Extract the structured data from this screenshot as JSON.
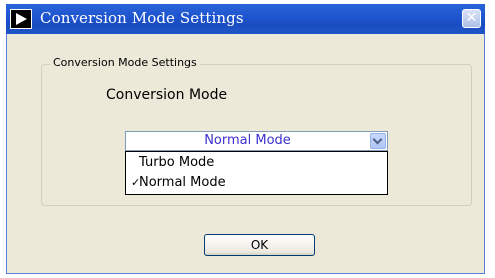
{
  "window": {
    "title": "Conversion Mode Settings",
    "close_symbol": "✕"
  },
  "group": {
    "label": "Conversion Mode Settings"
  },
  "field": {
    "label": "Conversion Mode",
    "selected_value": "Normal Mode"
  },
  "dropdown": {
    "options": [
      {
        "label": "Turbo Mode",
        "checked": false,
        "check_mark": ""
      },
      {
        "label": "Normal Mode",
        "checked": true,
        "check_mark": "✓"
      }
    ]
  },
  "buttons": {
    "ok_label": "OK"
  },
  "colors": {
    "title_bar": "#1d54cf",
    "dialog_bg": "#ece9d8",
    "selected_text": "#3b2fd0"
  },
  "icons": {
    "app": "play-arrow-icon",
    "dropdown": "chevron-down-icon",
    "close": "close-icon"
  }
}
